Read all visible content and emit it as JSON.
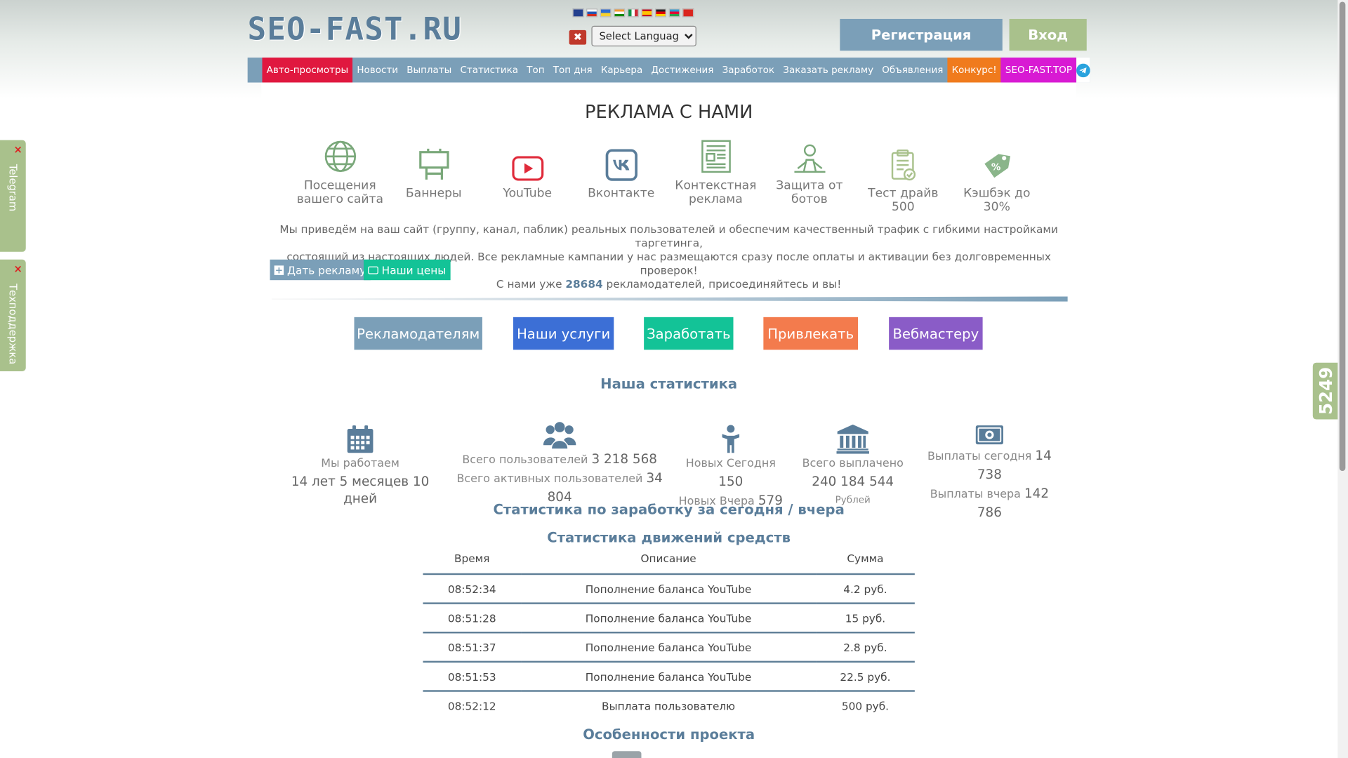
{
  "header": {
    "logo": "SEO-FAST.RU",
    "language_select": "Select Language",
    "register": "Регистрация",
    "login": "Вход"
  },
  "nav": [
    {
      "label": "Авто-просмотры",
      "style": "red"
    },
    {
      "label": "Новости"
    },
    {
      "label": "Выплаты"
    },
    {
      "label": "Статистика"
    },
    {
      "label": "Топ"
    },
    {
      "label": "Топ дня"
    },
    {
      "label": "Карьера"
    },
    {
      "label": "Достижения"
    },
    {
      "label": "Заработок"
    },
    {
      "label": "Заказать рекламу"
    },
    {
      "label": "Объявления"
    },
    {
      "label": "Конкурс!",
      "style": "orange"
    },
    {
      "label": "SEO-FAST.TOP",
      "style": "magenta"
    }
  ],
  "ads": {
    "title": "РЕКЛАМА С НАМИ",
    "services": [
      {
        "label": "Посещения вашего сайта",
        "icon": "globe-icon"
      },
      {
        "label": "Баннеры",
        "icon": "billboard-icon"
      },
      {
        "label": "YouTube",
        "icon": "youtube-icon"
      },
      {
        "label": "Вконтакте",
        "icon": "vk-icon"
      },
      {
        "label": "Контекстная реклама",
        "icon": "newspaper-icon"
      },
      {
        "label": "Защита от ботов",
        "icon": "robot-icon"
      },
      {
        "label": "Тест драйв 500",
        "icon": "clipboard-icon"
      },
      {
        "label": "Кэшбэк до 30%",
        "icon": "discount-tag-icon"
      }
    ],
    "desc_line1": "Мы приведём на ваш сайт (группу, канал, паблик) реальных пользователей и обеспечим качественный трафик с гибкими настройками таргетинга,",
    "desc_line2": "состоящий из настоящих людей. Все рекламные кампании у нас размещаются сразу после оплаты и активации без долговременных проверок!",
    "desc_line3_pre": "С нами уже",
    "advertisers_count": "28684",
    "desc_line3_post": "рекламодателей, присоединяйтесь и вы!",
    "btn_give_ad": "Дать рекламу",
    "btn_prices": "Наши цены"
  },
  "big_buttons": [
    {
      "label": "Рекламодателям",
      "color": "#7b9fb8"
    },
    {
      "label": "Наши услуги",
      "color": "#3c6fd6"
    },
    {
      "label": "Заработать",
      "color": "#13c397"
    },
    {
      "label": "Привлекать",
      "color": "#f37b4d"
    },
    {
      "label": "Вебмастеру",
      "color": "#8a5cc7"
    }
  ],
  "stats": {
    "title": "Наша статистика",
    "working_label": "Мы работаем",
    "working_value": "14 лет 5 месяцев 10 дней",
    "users_total_label": "Всего пользователей",
    "users_total": "3 218 568",
    "users_active_label": "Всего активных пользователей",
    "users_active": "34 804",
    "new_today_label": "Новых Сегодня",
    "new_today": "150",
    "new_yesterday_label": "Новых Вчера",
    "new_yesterday": "579",
    "paid_total_label": "Всего выплачено",
    "paid_total": "240 184 544",
    "paid_unit": "Рублей",
    "pay_today_label": "Выплаты сегодня",
    "pay_today": "14 738",
    "pay_yesterday_label": "Выплаты вчера",
    "pay_yesterday": "142 786"
  },
  "earn_stats_title": "Статистика по заработку за сегодня / вчера",
  "moves": {
    "title": "Статистика движений средств",
    "columns": [
      "Время",
      "Описание",
      "Сумма"
    ],
    "rows": [
      [
        "08:52:34",
        "Пополнение баланса YouTube",
        "4.2 руб."
      ],
      [
        "08:51:28",
        "Пополнение баланса YouTube",
        "15 руб."
      ],
      [
        "08:51:37",
        "Пополнение баланса YouTube",
        "2.8 руб."
      ],
      [
        "08:51:53",
        "Пополнение баланса YouTube",
        "22.5 руб."
      ],
      [
        "08:52:12",
        "Выплата пользователю",
        "500 руб."
      ]
    ]
  },
  "features_title": "Особенности проекта",
  "side": {
    "telegram": "Telegram",
    "support": "Техподдержка",
    "close": "×",
    "counter": "5249"
  },
  "colors": {
    "accent": "#7b9fb8",
    "green": "#a9c18c",
    "icon_green": "#7aa87a"
  }
}
